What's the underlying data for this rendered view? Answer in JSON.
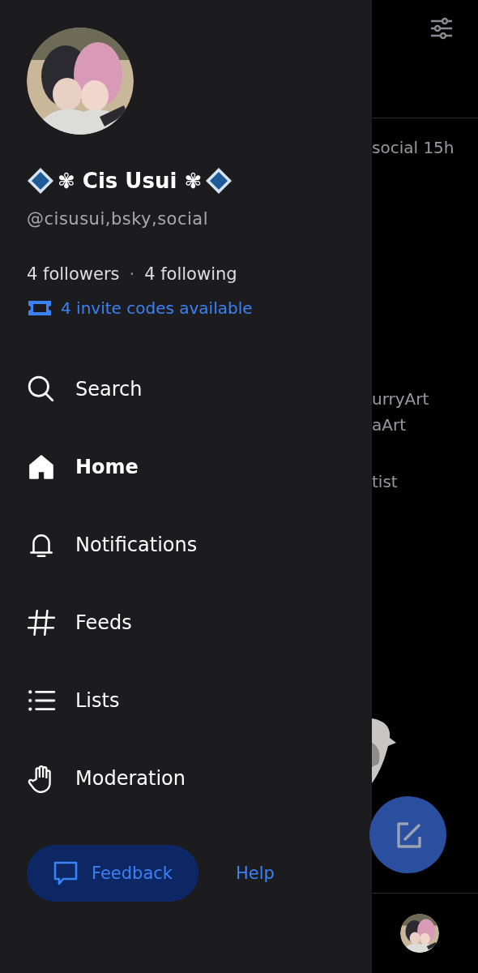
{
  "profile": {
    "name": "✾ Cis Usui ✾",
    "handle": "@cisusui,bsky,social",
    "followers": "4 followers",
    "separator": "·",
    "following": "4 following",
    "invites": "4 invite codes available"
  },
  "nav": [
    {
      "label": "Search",
      "selected": false
    },
    {
      "label": "Home",
      "selected": true
    },
    {
      "label": "Notifications",
      "selected": false
    },
    {
      "label": "Feeds",
      "selected": false
    },
    {
      "label": "Lists",
      "selected": false
    },
    {
      "label": "Moderation",
      "selected": false
    }
  ],
  "footer": {
    "feedback": "Feedback",
    "help": "Help"
  },
  "background_feed": {
    "post_meta": "social 15h",
    "lines": [
      "urryArt",
      "aArt",
      "tist"
    ]
  }
}
